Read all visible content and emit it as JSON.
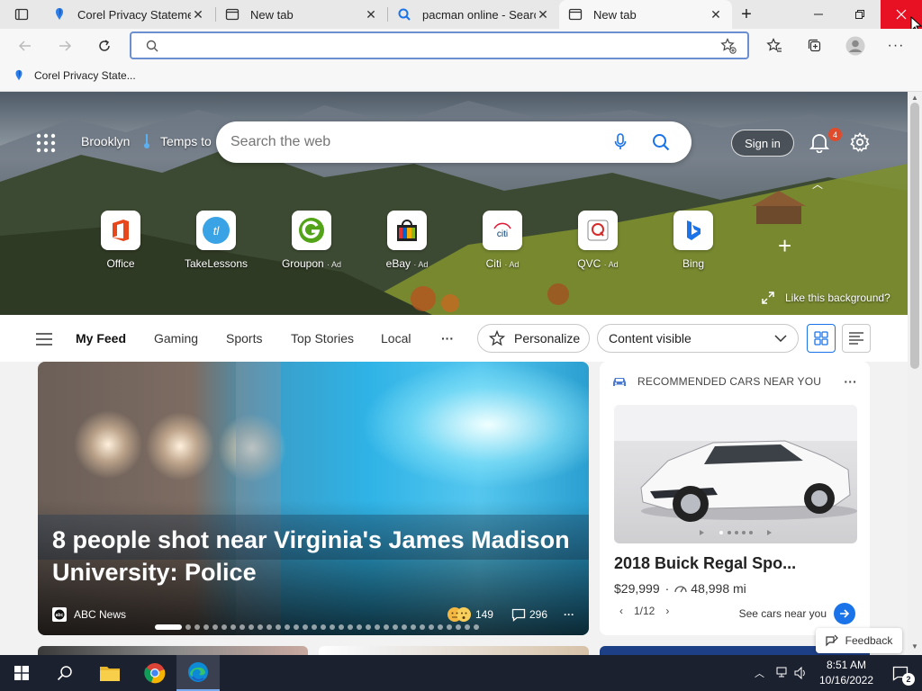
{
  "tabs": [
    {
      "label": "Corel Privacy Statement",
      "icon": "corel-balloon-icon"
    },
    {
      "label": "New tab",
      "icon": "new-tab-icon"
    },
    {
      "label": "pacman online - Search",
      "icon": "search-icon"
    },
    {
      "label": "New tab",
      "icon": "new-tab-icon"
    }
  ],
  "address": {
    "value": "",
    "placeholder": ""
  },
  "favorites": [
    {
      "label": "Corel Privacy State..."
    }
  ],
  "hero": {
    "location": "Brooklyn",
    "weather": "Temps to",
    "search_placeholder": "Search the web",
    "sign_in": "Sign in",
    "notification_count": "4",
    "like_background": "Like this background?",
    "quick_links": [
      {
        "label": "Office",
        "ad": ""
      },
      {
        "label": "TakeLessons",
        "ad": ""
      },
      {
        "label": "Groupon",
        "ad": "· Ad"
      },
      {
        "label": "eBay",
        "ad": "· Ad"
      },
      {
        "label": "Citi",
        "ad": "· Ad"
      },
      {
        "label": "QVC",
        "ad": "· Ad"
      },
      {
        "label": "Bing",
        "ad": ""
      }
    ]
  },
  "feed_nav": {
    "items": [
      "My Feed",
      "Gaming",
      "Sports",
      "Top Stories",
      "Local"
    ],
    "more": "···",
    "personalize": "Personalize",
    "content_select": "Content visible"
  },
  "main_story": {
    "headline": "8 people shot near Virginia's James Madison University: Police",
    "source": "ABC News",
    "reactions": "149",
    "comments": "296",
    "more": "···",
    "slide_count": 34,
    "active_slide": 0
  },
  "cars_card": {
    "header": "RECOMMENDED CARS NEAR YOU",
    "title": "2018 Buick Regal Spo...",
    "price": "$29,999",
    "miles": "48,998 mi",
    "pager": "1/12",
    "see_cars": "See cars near you"
  },
  "feedback": "Feedback",
  "clock": {
    "time": "8:51 AM",
    "date": "10/16/2022"
  },
  "notifications_badge": "2",
  "colors": {
    "accent": "#1a73e8",
    "taskbar": "#1c2130",
    "close_hover": "#e81123",
    "badge": "#e04b2b"
  }
}
